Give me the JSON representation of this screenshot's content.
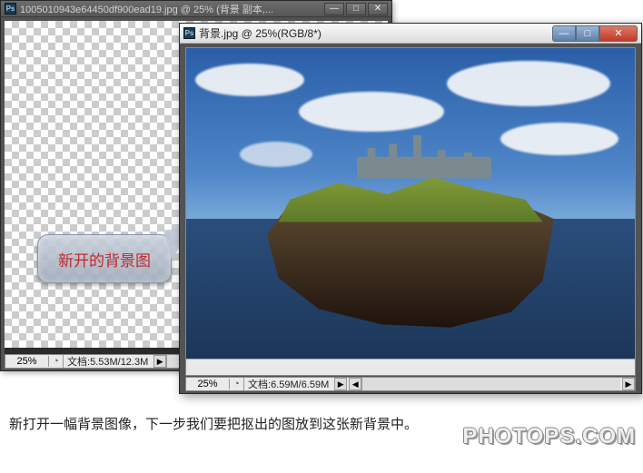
{
  "doc1": {
    "title": "1005010943e64450df900ead19.jpg @ 25% (背景 副本,...",
    "zoom": "25%",
    "status_label": "文档:",
    "status_size": "5.53M/12.3M"
  },
  "doc2": {
    "title": "背景.jpg @ 25%(RGB/8*)",
    "zoom": "25%",
    "status_label": "文档:",
    "status_size": "6.59M/6.59M"
  },
  "callout": {
    "text": "新开的背景图"
  },
  "caption": {
    "text": "新打开一幅背景图像，下一步我们要把抠出的图放到这张新背景中。"
  },
  "watermark": {
    "text": "PHOTOPS.COM"
  },
  "win_controls": {
    "minimize": "—",
    "maximize": "□",
    "close": "✕"
  },
  "icons": {
    "ps": "Ps",
    "circle": "◔",
    "arrow_right": "▶",
    "arrow_left": "◀"
  }
}
